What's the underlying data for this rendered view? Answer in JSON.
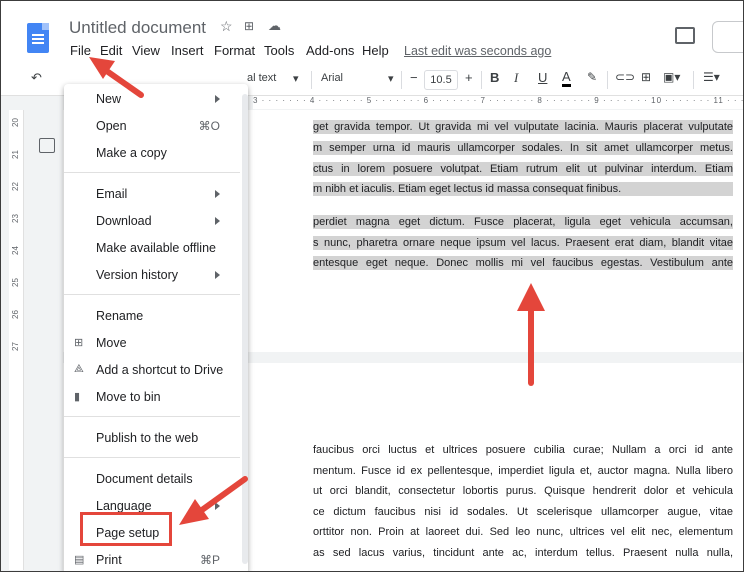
{
  "document": {
    "title": "Untitled document",
    "last_edit": "Last edit was seconds ago"
  },
  "menu_bar": [
    "File",
    "Edit",
    "View",
    "Insert",
    "Format",
    "Tools",
    "Add-ons",
    "Help"
  ],
  "toolbar": {
    "style": "al text",
    "font": "Arial",
    "font_size": "10.5",
    "bold": "B",
    "italic": "I",
    "underline": "U",
    "text_color": "A"
  },
  "ruler": "3 · · · · · · · 4 · · · · · · · 5 · · · · · · · 6 · · · · · · · 7 · · · · · · · 8 · · · · · · · 9 · · · · · · · 10 · · · · · · · 11 · · · · · · · 12 · · · · · · · 13 · · · · · · · 14 · · · · · · · 15 · · · · · · · 16 · · · · · · · 17 · · · · · 18",
  "left_ruler": [
    "20",
    "21",
    "22",
    "23",
    "24",
    "25",
    "26",
    "27"
  ],
  "file_menu": {
    "items": [
      {
        "label": "New",
        "submenu": true
      },
      {
        "label": "Open",
        "shortcut": "⌘O"
      },
      {
        "label": "Make a copy"
      },
      {
        "label": "Email",
        "submenu": true
      },
      {
        "label": "Download",
        "submenu": true
      },
      {
        "label": "Make available offline"
      },
      {
        "label": "Version history",
        "submenu": true
      },
      {
        "label": "Rename"
      },
      {
        "label": "Move",
        "icon": "folder-move-icon"
      },
      {
        "label": "Add a shortcut to Drive",
        "icon": "drive-shortcut-icon"
      },
      {
        "label": "Move to bin",
        "icon": "trash-icon"
      },
      {
        "label": "Publish to the web"
      },
      {
        "label": "Document details"
      },
      {
        "label": "Language",
        "submenu": true
      },
      {
        "label": "Page setup"
      },
      {
        "label": "Print",
        "shortcut": "⌘P",
        "icon": "printer-icon"
      }
    ]
  },
  "page1_lines": [
    "get gravida tempor. Ut gravida mi vel vulputate lacinia. Mauris placerat vulputate",
    "m semper urna id mauris ullamcorper sodales. In sit amet ullamcorper metus.",
    "ctus in lorem posuere volutpat. Etiam rutrum elit ut pulvinar interdum. Etiam",
    "m nibh et iaculis. Etiam eget lectus id massa consequat finibus.",
    "perdiet magna eget dictum. Fusce placerat, ligula eget vehicula accumsan,",
    "s nunc, pharetra ornare neque ipsum vel lacus. Praesent erat diam, blandit vitae",
    "entesque eget neque. Donec mollis mi vel faucibus egestas. Vestibulum ante"
  ],
  "page2_lines": [
    "faucibus orci luctus et ultrices posuere cubilia curae; Nullam a orci id ante",
    "mentum. Fusce id ex pellentesque, imperdiet ligula et, auctor magna. Nulla libero",
    "ut orci blandit, consectetur lobortis purus. Quisque hendrerit dolor et vehicula",
    "ce dictum faucibus nisi id sodales. Ut scelerisque ullamcorper augue, vitae",
    "orttitor non. Proin at laoreet dui. Sed leo nunc, ultrices vel elit nec, elementum",
    "as sed lacus varius, tincidunt ante ac, interdum tellus. Praesent nulla nulla,"
  ],
  "colors": {
    "annotation_red": "#e4463b",
    "docs_blue": "#4285f4",
    "selection_gray": "#d3d3d3"
  }
}
